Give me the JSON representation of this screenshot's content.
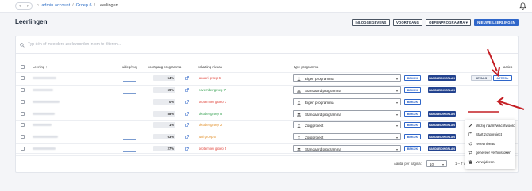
{
  "breadcrumb": {
    "home_glyph": "⌂",
    "account": "admin account",
    "sep": "/",
    "group": "Groep 6",
    "current": "Leerlingen"
  },
  "page": {
    "title": "Leerlingen"
  },
  "toolbar": {
    "inlog": "INLOGGEGEVENS",
    "voortgang": "VOORTGANG",
    "oefenprogramma": "OEFENPROGRAMMA ▾",
    "nieuwe": "NIEUWE LEERLINGEN"
  },
  "search": {
    "placeholder": "Typ één of meerdere zoekwoorden in om te filteren..."
  },
  "columns": {
    "leerling": "Leerling ↑",
    "uitleg": "uitleg/req",
    "voortgang": "voortgang programma",
    "schatting": "schatting niveau",
    "type": "type programma",
    "acties": "acties"
  },
  "rows": [
    {
      "pct": "54%",
      "niveau": "januari groep 6",
      "niveau_color": "#e0433a",
      "programma": "Eigen programma",
      "icon": "person-icon",
      "has_handl": true,
      "has_actions": true
    },
    {
      "pct": "69%",
      "niveau": "november groep 7",
      "niveau_color": "#2e9d4a",
      "programma": "Standaard programma",
      "icon": "group-icon",
      "has_handl": true,
      "has_actions": false
    },
    {
      "pct": "0%",
      "niveau": "september groep 3",
      "niveau_color": "#e0433a",
      "programma": "Eigen programma",
      "icon": "person-icon",
      "has_handl": false,
      "has_actions": false
    },
    {
      "pct": "88%",
      "niveau": "oktober groep 8",
      "niveau_color": "#2e9d4a",
      "programma": "Standaard programma",
      "icon": "group-icon",
      "has_handl": true,
      "has_actions": false
    },
    {
      "pct": "1%",
      "niveau": "oktober groep 2",
      "niveau_color": "#e08a1e",
      "programma": "Zorgproject",
      "icon": "person-icon",
      "has_handl": true,
      "has_actions": false
    },
    {
      "pct": "63%",
      "niveau": "juni groep 6",
      "niveau_color": "#e08a1e",
      "programma": "Zorgproject",
      "icon": "person-icon",
      "has_handl": true,
      "has_actions": true
    },
    {
      "pct": "27%",
      "niveau": "september groep 5",
      "niveau_color": "#e0433a",
      "programma": "Standaard programma",
      "icon": "group-icon",
      "has_handl": true,
      "has_actions": true
    }
  ],
  "row_buttons": {
    "bekijk": "BEKIJK",
    "handleiding": "HANDLEIDINGPLAN",
    "details": "DETAILS",
    "acties": "ACTIES ▾"
  },
  "menu": {
    "items": [
      {
        "label": "Wijzig naam/wachtwoord",
        "icon": "pencil-icon"
      },
      {
        "label": "Start zorgproject",
        "icon": "clipboard-icon"
      },
      {
        "label": "reset niveau",
        "icon": "reset-icon"
      },
      {
        "label": "genereer verhuistoken",
        "icon": "transfer-icon"
      },
      {
        "label": "Verwijderen",
        "icon": "trash-icon"
      }
    ]
  },
  "footer": {
    "per_page_label": "Aantal per pagina:",
    "per_page_value": "10",
    "range": "1 – 7 van 7"
  },
  "colors": {
    "primary": "#2f66c9",
    "dark_primary": "#23438f",
    "annotation": "#c41e24"
  }
}
